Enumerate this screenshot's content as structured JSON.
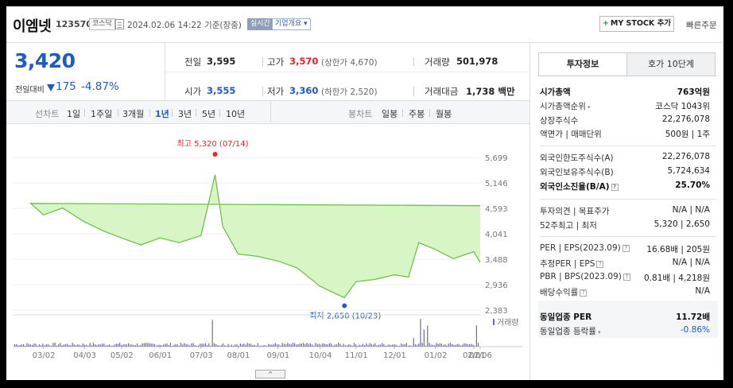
{
  "header": {
    "name": "이엠넷",
    "code": "123570",
    "market": "코스닥",
    "datetime": "2024.02.06 14:22 기준(장중)",
    "realtime": "실시간",
    "overview": "기업개요",
    "mystock": "MY STOCK 추가",
    "quick_order": "빠른주문"
  },
  "price": {
    "current": "3,420",
    "change_label": "전일대비",
    "change_value": "175",
    "change_pct": "-4.87%"
  },
  "quote": {
    "prev_label": "전일",
    "prev": "3,595",
    "high_label": "고가",
    "high": "3,570",
    "upper_limit": "(상한가 4,670)",
    "volume_label": "거래량",
    "volume": "501,978",
    "open_label": "시가",
    "open": "3,555",
    "low_label": "저가",
    "low": "3,360",
    "lower_limit": "(하한가 2,520)",
    "amount_label": "거래대금",
    "amount": "1,738 백만"
  },
  "period_tabs": {
    "line_label": "선차트",
    "line": [
      "1일",
      "1주일",
      "3개월",
      "1년",
      "3년",
      "5년",
      "10년"
    ],
    "selected": "1년",
    "candle_label": "봉차트",
    "candle": [
      "일봉",
      "주봉",
      "월봉"
    ]
  },
  "chart_data": {
    "type": "area",
    "x": [
      "02/06",
      "02/20",
      "03/02",
      "03/17",
      "04/03",
      "04/18",
      "05/02",
      "05/17",
      "06/01",
      "06/16",
      "07/03",
      "07/14",
      "07/20",
      "08/01",
      "08/16",
      "09/01",
      "09/16",
      "10/04",
      "10/23",
      "11/01",
      "11/16",
      "12/01",
      "12/12",
      "12/20",
      "01/02",
      "01/16",
      "02/01",
      "02/06"
    ],
    "y": [
      4650,
      4700,
      4450,
      4600,
      4300,
      4100,
      3950,
      3800,
      3950,
      3850,
      4000,
      5320,
      4200,
      3600,
      3550,
      3450,
      3300,
      2900,
      2650,
      3000,
      3050,
      3150,
      3100,
      3850,
      3700,
      3500,
      3650,
      3420
    ],
    "y_ticks": [
      "5,699",
      "5,146",
      "4,593",
      "4,041",
      "3,488",
      "2,936",
      "2,383"
    ],
    "x_ticks": [
      "02/06",
      "03/02",
      "04/03",
      "05/02",
      "06/01",
      "07/03",
      "08/01",
      "09/01",
      "10/04",
      "11/01",
      "12/01",
      "01/02",
      "02/01"
    ],
    "ylim": [
      2383,
      5699
    ],
    "high_annotation": "최고 5,320 (07/14)",
    "low_annotation": "최저 2,650 (10/23)",
    "volume_label": "거래량",
    "fill_color": "#d8f5c6",
    "line_color": "#6cc24a",
    "volume_color": "#6e6aa8"
  },
  "right_panel": {
    "tab_invest": "투자정보",
    "tab_order": "호가 10단계",
    "rows": [
      {
        "label": "시가총액",
        "value": "763억원"
      },
      {
        "label": "시가총액순위",
        "value": "코스닥 1043위"
      },
      {
        "label": "상장주식수",
        "value": "22,276,078"
      },
      {
        "label": "액면가 | 매매단위",
        "value": "500원 | 1주"
      },
      {
        "label": "외국인한도주식수(A)",
        "value": "22,276,078"
      },
      {
        "label": "외국인보유주식수(B)",
        "value": "5,724,634"
      },
      {
        "label": "외국인소진율(B/A)",
        "value": "25.70%"
      },
      {
        "label": "투자의견 | 목표주가",
        "value": "N/A | N/A"
      },
      {
        "label": "52주최고 | 최저",
        "value": "5,320 | 2,650"
      },
      {
        "label": "PER | EPS(2023.09)",
        "value": "16.68배 | 205원"
      },
      {
        "label": "추정PER | EPS",
        "value": "N/A | N/A"
      },
      {
        "label": "PBR | BPS(2023.09)",
        "value": "0.81배 | 4,218원"
      },
      {
        "label": "배당수익률",
        "value": "N/A"
      },
      {
        "label": "동일업종 PER",
        "value": "11.72배"
      },
      {
        "label": "동일업종 등락률",
        "value": "-0.86%"
      }
    ]
  },
  "collapse_icon": "chevron-up-icon"
}
